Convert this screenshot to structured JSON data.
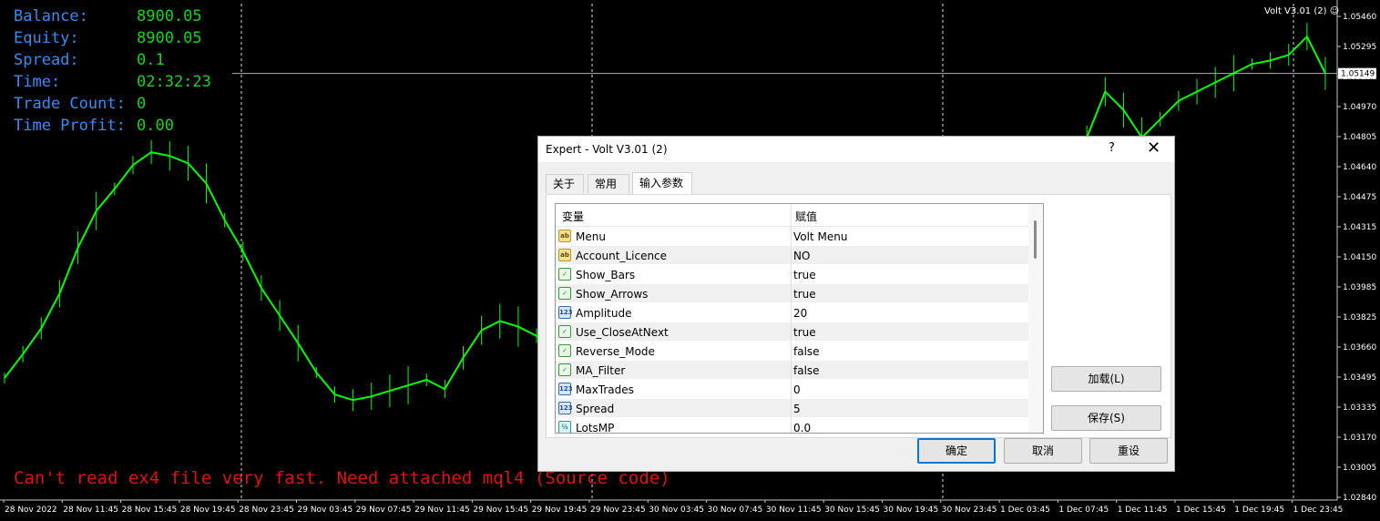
{
  "info_panel": [
    {
      "label": "Balance:",
      "value": "8900.05"
    },
    {
      "label": "Equity:",
      "value": "8900.05"
    },
    {
      "label": "Spread:",
      "value": "0.1"
    },
    {
      "label": "Time:",
      "value": "02:32:23"
    },
    {
      "label": "Trade Count:",
      "value": "0"
    },
    {
      "label": "Time Profit:",
      "value": "0.00"
    }
  ],
  "error_message": "Can't read ex4 file very fast. Need attached mql4 (Source code)",
  "ea_label": "Volt V3.01 (2)",
  "ea_face_icon": "smiley-icon",
  "chart_data": {
    "type": "line",
    "y_ticks": [
      "1.05460",
      "1.05295",
      "1.05130",
      "1.04970",
      "1.04805",
      "1.04640",
      "1.04475",
      "1.04315",
      "1.04150",
      "1.03985",
      "1.03825",
      "1.03660",
      "1.03495",
      "1.03335",
      "1.03170",
      "1.03005",
      "1.02840"
    ],
    "current_price": "1.05149",
    "x_ticks": [
      "28 Nov 2022",
      "28 Nov 11:45",
      "28 Nov 15:45",
      "28 Nov 19:45",
      "28 Nov 23:45",
      "29 Nov 03:45",
      "29 Nov 07:45",
      "29 Nov 11:45",
      "29 Nov 15:45",
      "29 Nov 19:45",
      "29 Nov 23:45",
      "30 Nov 03:45",
      "30 Nov 07:45",
      "30 Nov 11:45",
      "30 Nov 15:45",
      "30 Nov 19:45",
      "30 Nov 23:45",
      "1 Dec 03:45",
      "1 Dec 07:45",
      "1 Dec 11:45",
      "1 Dec 15:45",
      "1 Dec 19:45",
      "1 Dec 23:45"
    ],
    "series_color": "#00ff00",
    "price_points": [
      [
        0,
        1.0349
      ],
      [
        1,
        1.0362
      ],
      [
        2,
        1.0376
      ],
      [
        3,
        1.0395
      ],
      [
        4,
        1.042
      ],
      [
        5,
        1.044
      ],
      [
        6,
        1.0452
      ],
      [
        7,
        1.0465
      ],
      [
        8,
        1.0472
      ],
      [
        9,
        1.047
      ],
      [
        10,
        1.0466
      ],
      [
        11,
        1.0455
      ],
      [
        12,
        1.0435
      ],
      [
        13,
        1.0418
      ],
      [
        14,
        1.0398
      ],
      [
        15,
        1.0383
      ],
      [
        16,
        1.0368
      ],
      [
        17,
        1.0352
      ],
      [
        18,
        1.034
      ],
      [
        19,
        1.0337
      ],
      [
        20,
        1.0339
      ],
      [
        21,
        1.0342
      ],
      [
        22,
        1.0345
      ],
      [
        23,
        1.0348
      ],
      [
        24,
        1.0343
      ],
      [
        25,
        1.036
      ],
      [
        26,
        1.0375
      ],
      [
        27,
        1.038
      ],
      [
        28,
        1.0377
      ],
      [
        29,
        1.0372
      ],
      [
        30,
        1.0365
      ],
      [
        31,
        1.0362
      ],
      [
        32,
        1.0355
      ],
      [
        33,
        1.036
      ],
      [
        34,
        1.0352
      ],
      [
        35,
        1.0345
      ],
      [
        36,
        1.033
      ],
      [
        37,
        1.0345
      ],
      [
        38,
        1.0352
      ],
      [
        39,
        1.0345
      ],
      [
        40,
        1.034
      ],
      [
        41,
        1.0335
      ],
      [
        42,
        1.0338
      ],
      [
        43,
        1.0338
      ],
      [
        44,
        1.0338
      ],
      [
        45,
        1.034
      ],
      [
        46,
        1.0342
      ],
      [
        47,
        1.0343
      ],
      [
        48,
        1.034
      ],
      [
        49,
        1.0335
      ],
      [
        50,
        1.032
      ],
      [
        51,
        1.0305
      ],
      [
        52,
        1.031
      ],
      [
        53,
        1.0318
      ],
      [
        54,
        1.033
      ],
      [
        55,
        1.0345
      ],
      [
        56,
        1.037
      ],
      [
        57,
        1.04
      ],
      [
        58,
        1.044
      ],
      [
        59,
        1.048
      ],
      [
        60,
        1.0505
      ],
      [
        61,
        1.0495
      ],
      [
        62,
        1.048
      ],
      [
        63,
        1.049
      ],
      [
        64,
        1.05
      ],
      [
        65,
        1.0505
      ],
      [
        66,
        1.051
      ],
      [
        67,
        1.0515
      ],
      [
        68,
        1.052
      ],
      [
        69,
        1.0522
      ],
      [
        70,
        1.0525
      ],
      [
        71,
        1.0535
      ],
      [
        72,
        1.0515
      ]
    ]
  },
  "dialog": {
    "title": "Expert - Volt V3.01 (2)",
    "help": "?",
    "close": "✕",
    "tabs": [
      "关于",
      "常用",
      "输入参数"
    ],
    "grid": {
      "col_variable": "变量",
      "col_value": "赋值",
      "rows": [
        {
          "icon": "ab",
          "icon_name": "string-type-icon",
          "name": "Menu",
          "value": "Volt Menu"
        },
        {
          "icon": "ab",
          "icon_name": "string-type-icon",
          "name": "Account_Licence",
          "value": "NO"
        },
        {
          "icon": "✓",
          "icon_name": "bool-type-icon",
          "name": "Show_Bars",
          "value": "true"
        },
        {
          "icon": "✓",
          "icon_name": "bool-type-icon",
          "name": "Show_Arrows",
          "value": "true"
        },
        {
          "icon": "123",
          "icon_name": "int-type-icon",
          "name": "Amplitude",
          "value": "20"
        },
        {
          "icon": "✓",
          "icon_name": "bool-type-icon",
          "name": "Use_CloseAtNext",
          "value": "true"
        },
        {
          "icon": "✓",
          "icon_name": "bool-type-icon",
          "name": "Reverse_Mode",
          "value": "false"
        },
        {
          "icon": "✓",
          "icon_name": "bool-type-icon",
          "name": "MA_Filter",
          "value": "false"
        },
        {
          "icon": "123",
          "icon_name": "int-type-icon",
          "name": "MaxTrades",
          "value": "0"
        },
        {
          "icon": "123",
          "icon_name": "int-type-icon",
          "name": "Spread",
          "value": "5"
        },
        {
          "icon": "½",
          "icon_name": "double-type-icon",
          "name": "LotsMP",
          "value": "0.0"
        }
      ]
    },
    "buttons": {
      "load": "加载(L)",
      "save": "保存(S)",
      "ok": "确定",
      "cancel": "取消",
      "reset": "重设"
    }
  }
}
